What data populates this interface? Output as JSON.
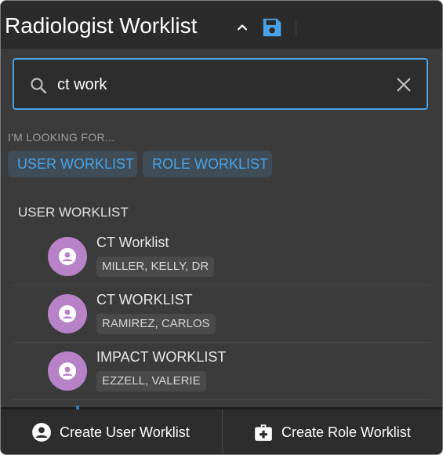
{
  "header": {
    "title": "Radiologist Worklist",
    "chevron_icon": "chevron-up-icon",
    "save_icon": "save-icon",
    "accent_color": "#4aa3e6"
  },
  "search": {
    "value": "ct work",
    "placeholder": "",
    "search_icon": "search-icon",
    "clear_icon": "close-icon"
  },
  "filters": {
    "heading": "I'M LOOKING FOR...",
    "chips": [
      "USER WORKLIST",
      "ROLE WORKLIST"
    ]
  },
  "results": {
    "section_title": "USER WORKLIST",
    "items": [
      {
        "name": "CT Worklist",
        "owner": "MILLER, KELLY, DR",
        "icon": "user-avatar-icon"
      },
      {
        "name": "CT WORKLIST",
        "owner": "RAMIREZ, CARLOS",
        "icon": "user-avatar-icon"
      },
      {
        "name": "IMPACT WORKLIST",
        "owner": "EZZELL, VALERIE",
        "icon": "user-avatar-icon"
      }
    ]
  },
  "footer": {
    "create_user_label": "Create User Worklist",
    "create_role_label": "Create Role Worklist",
    "create_user_icon": "account-circle-icon",
    "create_role_icon": "medical-bag-icon"
  }
}
